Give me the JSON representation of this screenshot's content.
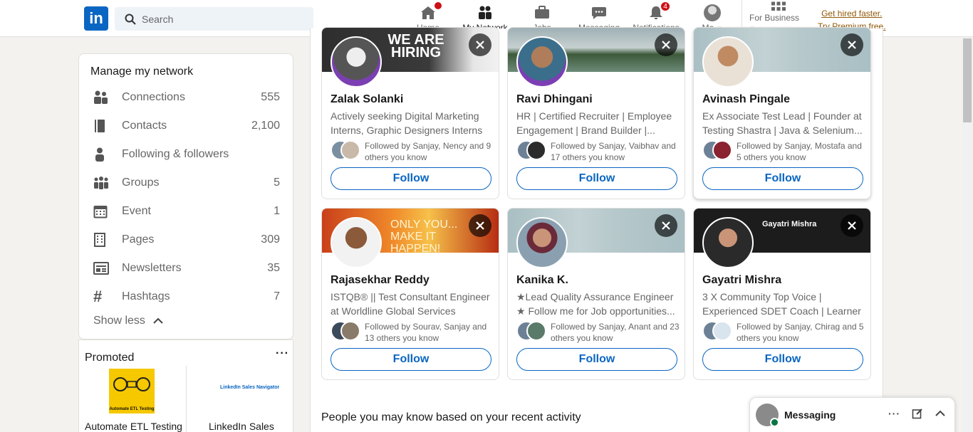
{
  "nav": {
    "search_placeholder": "Search",
    "items": [
      {
        "label": "Home",
        "badge": ""
      },
      {
        "label": "My Network",
        "badge": ""
      },
      {
        "label": "Jobs",
        "badge": ""
      },
      {
        "label": "Messaging",
        "badge": ""
      },
      {
        "label": "Notifications",
        "badge": "4"
      },
      {
        "label": "Me",
        "badge": ""
      },
      {
        "label": "For Business",
        "badge": ""
      }
    ],
    "premium_line1": "Get hired faster.",
    "premium_line2": "Try Premium free."
  },
  "sidebar": {
    "title": "Manage my network",
    "items": [
      {
        "label": "Connections",
        "count": "555",
        "icon": "people-icon"
      },
      {
        "label": "Contacts",
        "count": "2,100",
        "icon": "contact-book-icon"
      },
      {
        "label": "Following & followers",
        "count": "",
        "icon": "person-icon"
      },
      {
        "label": "Groups",
        "count": "5",
        "icon": "group-icon"
      },
      {
        "label": "Event",
        "count": "1",
        "icon": "calendar-icon"
      },
      {
        "label": "Pages",
        "count": "309",
        "icon": "building-icon"
      },
      {
        "label": "Newsletters",
        "count": "35",
        "icon": "newspaper-icon"
      },
      {
        "label": "Hashtags",
        "count": "7",
        "icon": "hashtag-icon"
      }
    ],
    "show_less": "Show less"
  },
  "promoted": {
    "title": "Promoted",
    "ad1_image_text": "Automate ETL Testing",
    "ad1_caption": "Automate ETL Testing",
    "ad2_image_text": "LinkedIn Sales Navigator",
    "ad2_caption": "LinkedIn Sales"
  },
  "cards": [
    {
      "name": "Zalak Solanki",
      "headline": "Actively seeking Digital Marketing Interns, Graphic Designers Interns ,...",
      "mutual": "Followed by Sanjay, Nency and 9 others you know",
      "banner_text": "WE ARE HIRING",
      "follow": "Follow"
    },
    {
      "name": "Ravi Dhingani",
      "headline": "HR | Certified Recruiter | Employee Engagement | Brand Builder |...",
      "mutual": "Followed by Sanjay, Vaibhav and 17 others you know",
      "banner_text": "",
      "follow": "Follow"
    },
    {
      "name": "Avinash Pingale",
      "headline": "Ex Associate Test Lead | Founder at Testing Shastra | Java & Selenium...",
      "mutual": "Followed by Sanjay, Mostafa and 5 others you know",
      "banner_text": "",
      "follow": "Follow"
    },
    {
      "name": "Rajasekhar Reddy",
      "headline": "ISTQB® || Test Consultant Engineer at Worldline Global Services",
      "mutual": "Followed by Sourav, Sanjay and 13 others you know",
      "banner_text": "ONLY YOU... MAKE IT HAPPEN!",
      "follow": "Follow"
    },
    {
      "name": "Kanika K.",
      "headline": "★Lead Quality Assurance Engineer ★ Follow me for Job opportunities...",
      "mutual": "Followed by Sanjay, Anant and 23 others you know",
      "banner_text": "",
      "follow": "Follow"
    },
    {
      "name": "Gayatri Mishra",
      "headline": "3 X Community Top Voice | Experienced SDET Coach | Learner ...",
      "mutual": "Followed by Sanjay, Chirag and 5 others you know",
      "banner_text": "Gayatri Mishra",
      "follow": "Follow"
    }
  ],
  "section_title": "People you may know based on your recent activity",
  "messaging": {
    "title": "Messaging"
  },
  "colors": {
    "brand": "#0a66c2",
    "badge": "#cc1016",
    "premium": "#915907"
  }
}
